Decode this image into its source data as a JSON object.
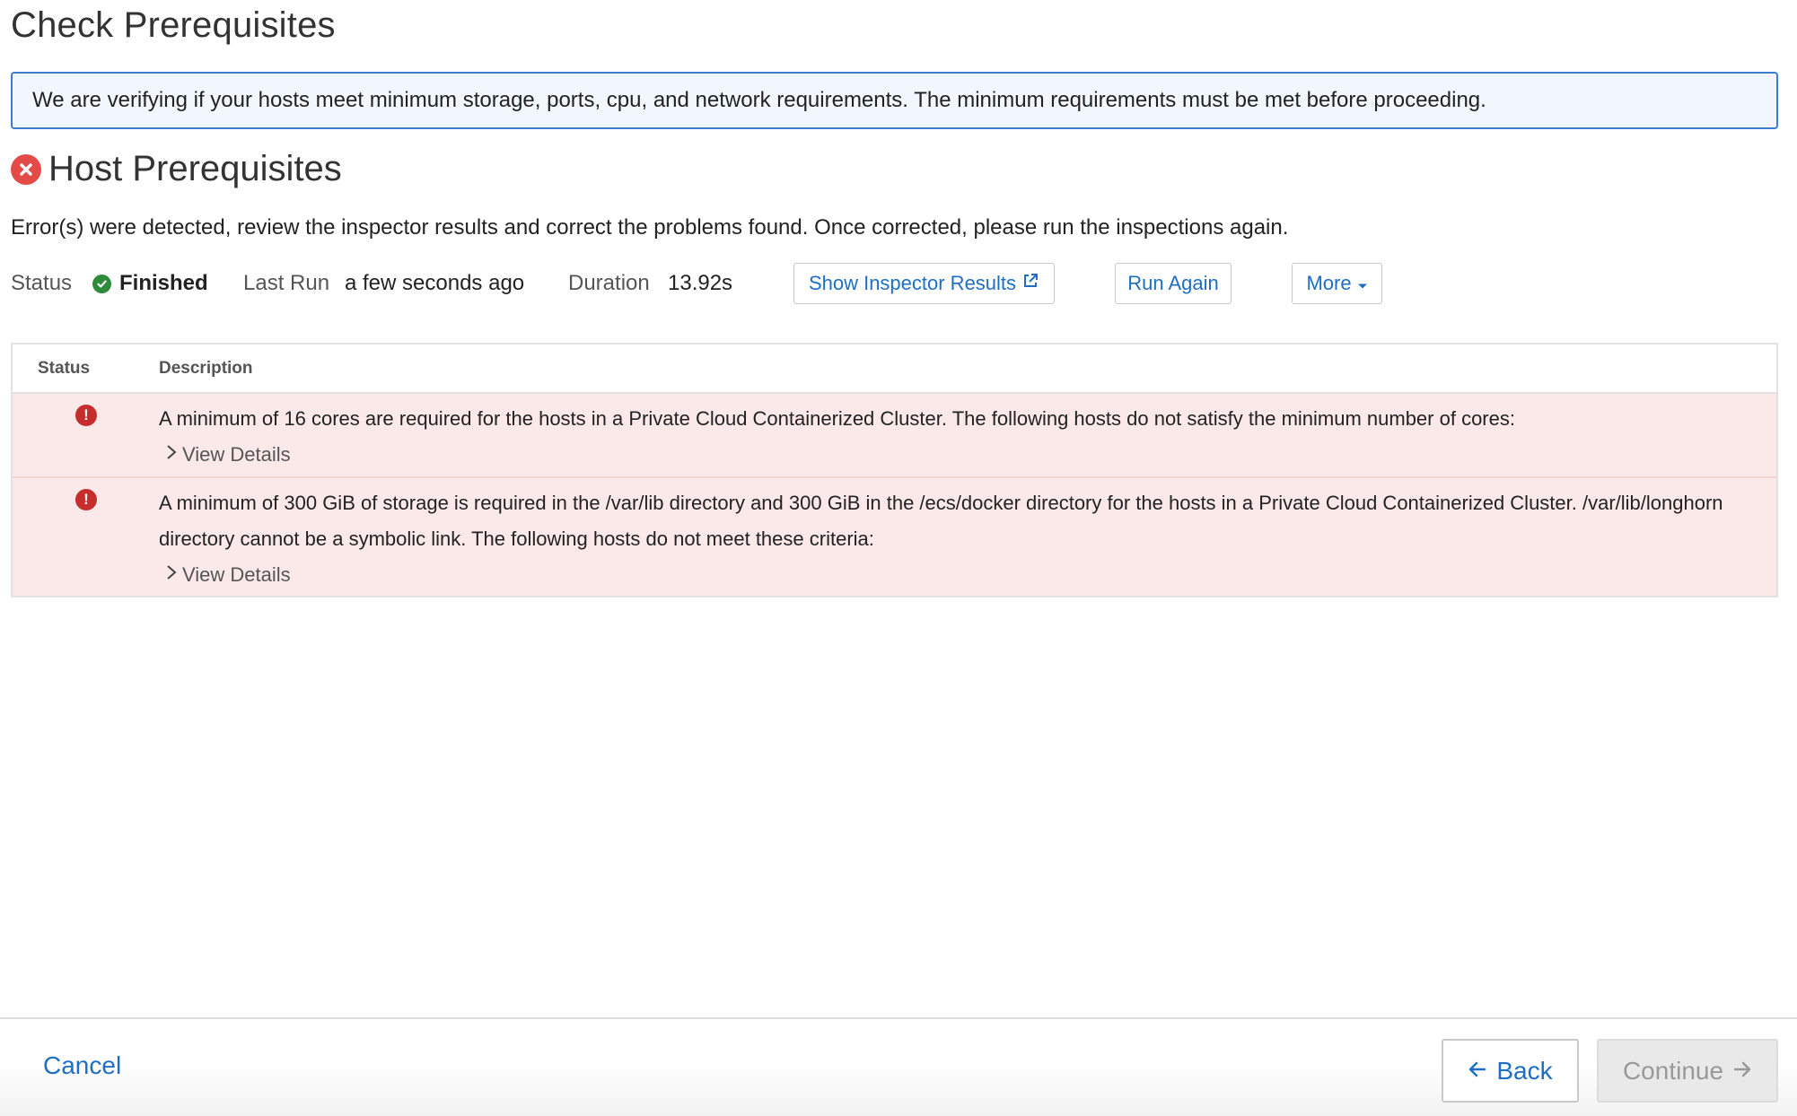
{
  "page": {
    "title": "Check Prerequisites",
    "info_message": "We are verifying if your hosts meet minimum storage, ports, cpu, and network requirements. The minimum requirements must be met before proceeding."
  },
  "host_prerequisites": {
    "title": "Host Prerequisites",
    "status_icon": "error-circle-icon",
    "error_message": "Error(s) were detected, review the inspector results and correct the problems found. Once corrected, please run the inspections again."
  },
  "status_bar": {
    "status_label": "Status",
    "status_value": "Finished",
    "status_icon": "check-circle-icon",
    "last_run_label": "Last Run",
    "last_run_value": "a few seconds ago",
    "duration_label": "Duration",
    "duration_value": "13.92s",
    "show_results_label": "Show Inspector Results",
    "run_again_label": "Run Again",
    "more_label": "More"
  },
  "results_table": {
    "columns": [
      "Status",
      "Description"
    ],
    "rows": [
      {
        "status": "error",
        "description": "A minimum of 16 cores are required for the hosts in a Private Cloud Containerized Cluster. The following hosts do not satisfy the minimum number of cores:",
        "details_label": "View Details"
      },
      {
        "status": "error",
        "description": "A minimum of 300 GiB of storage is required in the /var/lib directory and 300 GiB in the /ecs/docker directory for the hosts in a Private Cloud Containerized Cluster. /var/lib/longhorn directory cannot be a symbolic link. The following hosts do not meet these criteria:",
        "details_label": "View Details"
      }
    ]
  },
  "footer": {
    "cancel_label": "Cancel",
    "back_label": "Back",
    "continue_label": "Continue"
  },
  "colors": {
    "accent": "#1f6ec5",
    "info_border": "#3a7bd5",
    "error": "#e34b48",
    "success": "#2e8b3a",
    "error_row_bg": "#fbe9e9"
  }
}
